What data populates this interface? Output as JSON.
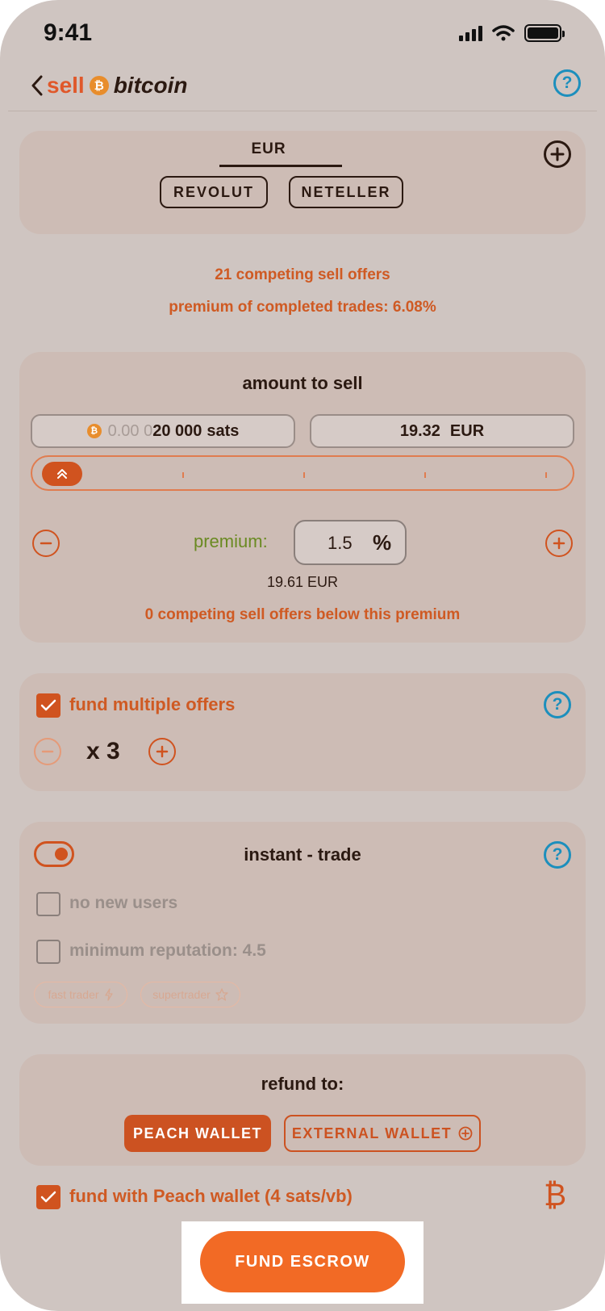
{
  "status_bar": {
    "time": "9:41"
  },
  "header": {
    "title_sell": "sell",
    "coin_symbol": "₿",
    "title_brand": "bitcoin",
    "help_icon": "question-circle-icon"
  },
  "payment_methods": {
    "currency_tab": "EUR",
    "methods": [
      "REVOLUT",
      "NETELLER"
    ],
    "add_icon": "plus-circle-icon"
  },
  "market_info": {
    "competing": "21 competing sell offers",
    "premium_completed": "premium of completed trades: 6.08%"
  },
  "amount": {
    "title": "amount to sell",
    "sats_dim": "0.00 0",
    "sats_value": "20 000",
    "sats_unit": "sats",
    "fiat_value": "19.32",
    "fiat_currency": "EUR",
    "slider_thumb_icon": "double-chevron-up-icon",
    "premium_label": "premium:",
    "premium_value": "1.5",
    "premium_unit": "%",
    "premium_price": "19.61 EUR",
    "competing_below": "0 competing sell offers below this premium"
  },
  "multiple_offers": {
    "label": "fund multiple offers",
    "checked": true,
    "count": "x 3"
  },
  "instant_trade": {
    "label": "instant - trade",
    "enabled": true,
    "no_new_users": "no new users",
    "min_reputation": "minimum reputation: 4.5",
    "badges": [
      "fast trader",
      "supertrader"
    ]
  },
  "refund": {
    "title": "refund to:",
    "peach_wallet": "PEACH WALLET",
    "external_wallet": "EXTERNAL WALLET"
  },
  "fund_with_peach": {
    "label": "fund with Peach wallet (4 sats/vb)",
    "checked": true,
    "icon": "bitcoin-icon"
  },
  "cta": {
    "label": "FUND ESCROW"
  },
  "colors": {
    "accent": "#f26a25",
    "brand_orange": "#d0531f",
    "help_blue": "#1c8fbd",
    "premium_green": "#6a8a22"
  }
}
